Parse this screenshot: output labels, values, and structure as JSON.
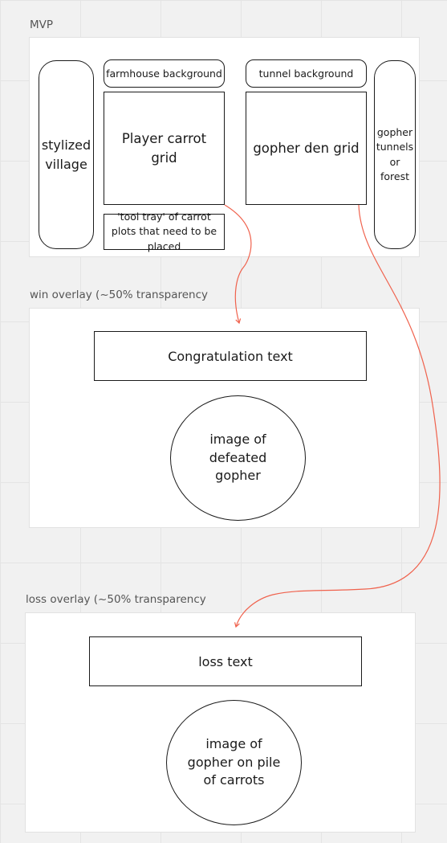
{
  "mvp": {
    "label": "MVP",
    "village": "stylized village",
    "farmhouse_bg": "farmhouse background",
    "tunnel_bg": "tunnel background",
    "player_grid": "Player carrot grid",
    "gopher_grid": "gopher den grid",
    "tunnels_forest": "gopher tunnels or forest",
    "tool_tray": "'tool tray' of carrot plots that need to be placed"
  },
  "win": {
    "label": "win overlay (~50% transparency",
    "text_box": "Congratulation text",
    "image": "image of defeated gopher"
  },
  "loss": {
    "label": "loss overlay (~50% transparency",
    "text_box": "loss text",
    "image": "image of gopher on pile of carrots"
  },
  "colors": {
    "connector": "#f0624d",
    "border": "#1a1a1a",
    "frame_fill": "#ffffff",
    "canvas": "#f1f1f1"
  }
}
